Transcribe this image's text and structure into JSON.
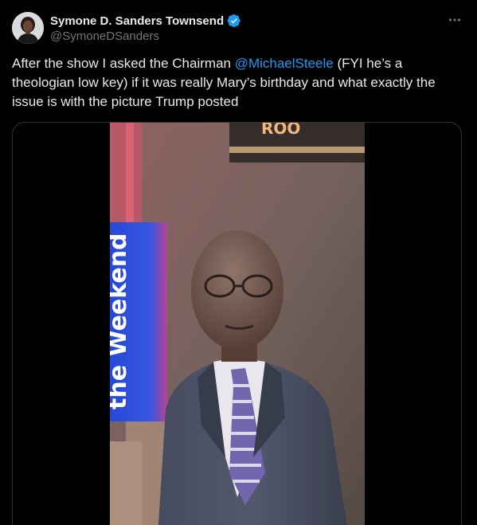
{
  "author": {
    "display_name": "Symone D. Sanders Townsend",
    "handle": "@SymoneDSanders",
    "verified": true,
    "verified_color": "#1d9bf0"
  },
  "tweet": {
    "text_before": "After the show I asked the Chairman ",
    "mention": "@MichaelSteele",
    "text_after": " (FYI he’s a theologian low key) if it was really Mary’s birthday and what exactly the issue is with the picture Trump posted"
  },
  "media": {
    "type": "video",
    "background_sign_text": "the Weekend",
    "neon_sign_text": "ROO"
  },
  "icons": {
    "more": "more-horizontal-icon",
    "verified": "verified-badge-icon"
  },
  "colors": {
    "background": "#000000",
    "text": "#e7e9ea",
    "secondary_text": "#71767b",
    "link": "#1d9bf0",
    "border": "#2f3336"
  }
}
